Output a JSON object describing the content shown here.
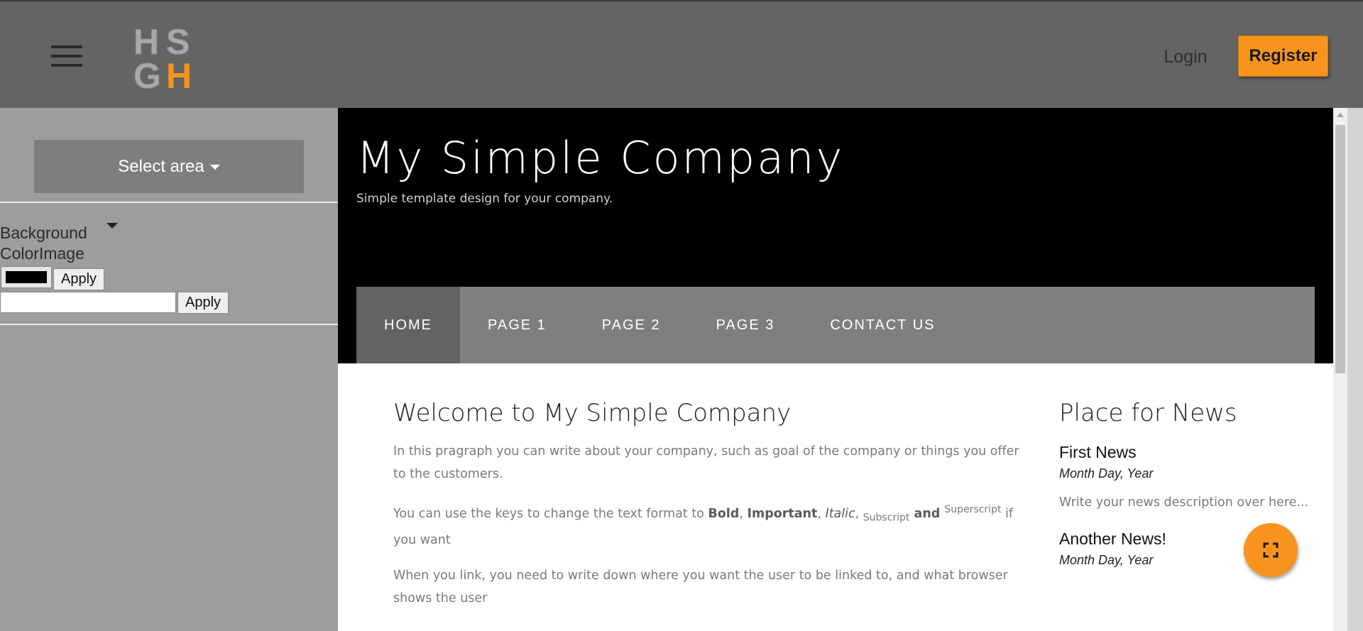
{
  "header": {
    "menu_icon": "hamburger-menu-icon",
    "logo_letters": [
      "H",
      "S",
      "G",
      "H"
    ],
    "login_label": "Login",
    "register_label": "Register",
    "colors": {
      "bar": "#646464",
      "accent": "#f7941d"
    }
  },
  "sidebar": {
    "select_area_label": "Select area",
    "background_label": "Background ColorImage",
    "color_value": "#000000",
    "apply_color_label": "Apply",
    "image_value": "",
    "apply_image_label": "Apply"
  },
  "site": {
    "title": "My Simple Company",
    "subtitle": "Simple template design for your company.",
    "nav": [
      "HOME",
      "PAGE 1",
      "PAGE 2",
      "PAGE 3",
      "CONTACT US"
    ],
    "active_nav": "HOME",
    "welcome_heading": "Welcome to My Simple Company",
    "para1": "In this pragraph you can write about your company, such as goal of the company or things you offer to the customers.",
    "para2": {
      "intro": "You can use the keys to change the text format to ",
      "bold": "Bold",
      "sep1": ", ",
      "important": "Important",
      "sep2": ", ",
      "italic": "Italic",
      "sep3": ", ",
      "subscript": "Subscript",
      "and": " and ",
      "superscript": "Superscript",
      "outro": " if you want"
    },
    "para3": "When you link, you need to write down where you want the user to be linked to, and what browser shows the user",
    "news_heading": "Place for News",
    "news": [
      {
        "title": "First News",
        "date": "Month Day, Year",
        "desc": "Write your news description over here..."
      },
      {
        "title": "Another News!",
        "date": "Month Day, Year"
      }
    ]
  },
  "fab_icon": "fullscreen-icon"
}
